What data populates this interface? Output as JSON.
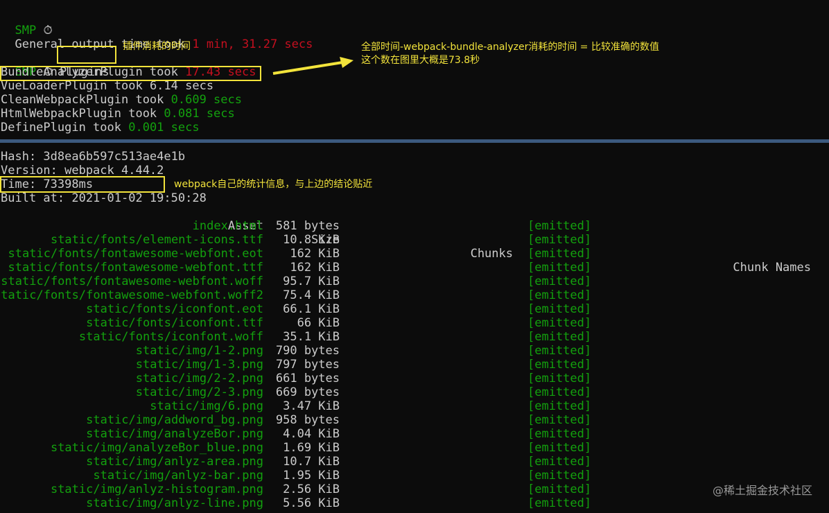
{
  "smp_top": {
    "label": "SMP",
    "timer_glyph": "⏱"
  },
  "general": {
    "prefix": "General output time took ",
    "value": "1 min, 31.27 secs"
  },
  "smp_plugins": {
    "label": "SMP",
    "timer_glyph": "⏱",
    "title": "Plugins"
  },
  "plugins": [
    {
      "name": "BundleAnalyzerPlugin took ",
      "time": "17.43 secs",
      "color": "#c50f1f"
    },
    {
      "name": "VueLoaderPlugin took ",
      "time": "6.14 secs",
      "color": "#cccccc"
    },
    {
      "name": "CleanWebpackPlugin took ",
      "time": "0.609 secs",
      "color": "#13a10e"
    },
    {
      "name": "HtmlWebpackPlugin took ",
      "time": "0.081 secs",
      "color": "#13a10e"
    },
    {
      "name": "DefinePlugin took ",
      "time": "0.001 secs",
      "color": "#13a10e"
    }
  ],
  "annotations": {
    "plugins_note": "插件消耗的时间",
    "bundle_note_line1": "全部时间-webpack-bundle-analyzer消耗的时间 = 比较准确的数值",
    "bundle_note_line2": "这个数在图里大概是73.8秒",
    "time_note": "webpack自己的统计信息，与上边的结论贴近"
  },
  "stats": {
    "hash": "Hash: 3d8ea6b597c513ae4e1b",
    "version": "Version: webpack 4.44.2",
    "time": "Time: 73398ms",
    "built_at": "Built at: 2021-01-02 19:50:28"
  },
  "table": {
    "headers": {
      "asset": "Asset",
      "size": "Size",
      "chunks": "Chunks",
      "chunk_names": "Chunk Names"
    },
    "rows": [
      {
        "asset": "index.html",
        "size": "581 bytes",
        "status": "[emitted]"
      },
      {
        "asset": "static/fonts/element-icons.ttf",
        "size": "10.8 KiB",
        "status": "[emitted]"
      },
      {
        "asset": "static/fonts/fontawesome-webfont.eot",
        "size": "162 KiB",
        "status": "[emitted]"
      },
      {
        "asset": "static/fonts/fontawesome-webfont.ttf",
        "size": "162 KiB",
        "status": "[emitted]"
      },
      {
        "asset": "static/fonts/fontawesome-webfont.woff",
        "size": "95.7 KiB",
        "status": "[emitted]"
      },
      {
        "asset": "static/fonts/fontawesome-webfont.woff2",
        "size": "75.4 KiB",
        "status": "[emitted]"
      },
      {
        "asset": "static/fonts/iconfont.eot",
        "size": "66.1 KiB",
        "status": "[emitted]"
      },
      {
        "asset": "static/fonts/iconfont.ttf",
        "size": "66 KiB",
        "status": "[emitted]"
      },
      {
        "asset": "static/fonts/iconfont.woff",
        "size": "35.1 KiB",
        "status": "[emitted]"
      },
      {
        "asset": "static/img/1-2.png",
        "size": "790 bytes",
        "status": "[emitted]"
      },
      {
        "asset": "static/img/1-3.png",
        "size": "797 bytes",
        "status": "[emitted]"
      },
      {
        "asset": "static/img/2-2.png",
        "size": "661 bytes",
        "status": "[emitted]"
      },
      {
        "asset": "static/img/2-3.png",
        "size": "669 bytes",
        "status": "[emitted]"
      },
      {
        "asset": "static/img/6.png",
        "size": "3.47 KiB",
        "status": "[emitted]"
      },
      {
        "asset": "static/img/addword_bg.png",
        "size": "958 bytes",
        "status": "[emitted]"
      },
      {
        "asset": "static/img/analyzeBor.png",
        "size": "4.04 KiB",
        "status": "[emitted]"
      },
      {
        "asset": "static/img/analyzeBor_blue.png",
        "size": "1.69 KiB",
        "status": "[emitted]"
      },
      {
        "asset": "static/img/anlyz-area.png",
        "size": "10.7 KiB",
        "status": "[emitted]"
      },
      {
        "asset": "static/img/anlyz-bar.png",
        "size": "1.95 KiB",
        "status": "[emitted]"
      },
      {
        "asset": "static/img/anlyz-histogram.png",
        "size": "2.56 KiB",
        "status": "[emitted]"
      },
      {
        "asset": "static/img/anlyz-line.png",
        "size": "5.56 KiB",
        "status": "[emitted]"
      }
    ]
  },
  "watermark": "@稀土掘金技术社区",
  "colors": {
    "accent": "#f2e33b",
    "green": "#13a10e",
    "red": "#c50f1f",
    "text": "#cccccc",
    "divider": "#3c5a7f"
  }
}
